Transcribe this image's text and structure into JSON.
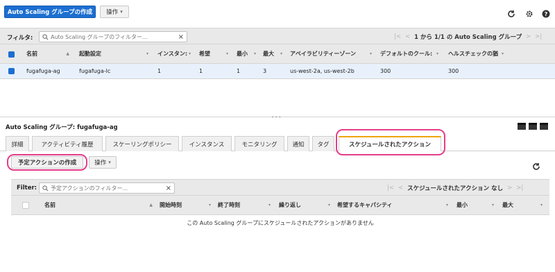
{
  "toolbar": {
    "create_asg_label": "Auto Scaling グループの作成",
    "actions_label": "操作",
    "icons": [
      "refresh-icon",
      "gear-icon",
      "help-icon"
    ]
  },
  "asg_filter": {
    "label": "フィルタ:",
    "placeholder": "Auto Scaling グループのフィルター...",
    "pagination": "1 から 1/1 の Auto Scaling グループ"
  },
  "asg_table": {
    "columns": [
      "名前",
      "起動設定",
      "インスタン:",
      "希望",
      "最小",
      "最大",
      "アベイラビリティーゾーン",
      "デフォルトのクール:",
      "ヘルスチェックの猶"
    ],
    "rows": [
      [
        "fugafuga-ag",
        "fugafuga-lc",
        "1",
        "1",
        "1",
        "3",
        "us-west-2a, us-west-2b",
        "300",
        "300"
      ]
    ]
  },
  "details": {
    "title": "Auto Scaling グループ: fugafuga-ag",
    "tabs": [
      "詳細",
      "アクティビティ履歴",
      "スケーリングポリシー",
      "インスタンス",
      "モニタリング",
      "通知",
      "タグ",
      "スケジュールされたアクション"
    ],
    "active_tab": "スケジュールされたアクション",
    "create_scheduled_label": "予定アクションの作成",
    "actions_label": "操作"
  },
  "sched_filter": {
    "label": "Filter:",
    "placeholder": "予定アクションのフィルター...",
    "pagination": "スケジュールされたアクション なし"
  },
  "sched_table": {
    "columns": [
      "名前",
      "開始時刻",
      "終了時刻",
      "繰り返し",
      "希望するキャパシティ",
      "最小",
      "最大"
    ],
    "empty_message": "この Auto Scaling グループにスケジュールされたアクションがありません"
  },
  "colors": {
    "primary": "#1c6fd1",
    "highlight": "#e53d8a",
    "active_tab_accent": "#f0a500"
  }
}
